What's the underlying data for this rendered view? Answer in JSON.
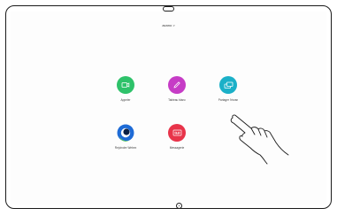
{
  "device": {
    "header_text": "acano >"
  },
  "apps": [
    {
      "label": "Appeler",
      "icon": "video-camera-icon",
      "color": "#2ec26a"
    },
    {
      "label": "Tableau blanc",
      "icon": "pencil-icon",
      "color": "#c63cc6"
    },
    {
      "label": "Partager l'écran",
      "icon": "share-screen-icon",
      "color": "#1bb0c8"
    },
    {
      "label": "Rejoindre Webex",
      "icon": "webex-icon",
      "color": "#1e6bd6"
    },
    {
      "label": "Messagerie",
      "icon": "voicemail-icon",
      "color": "#e8344a"
    }
  ]
}
